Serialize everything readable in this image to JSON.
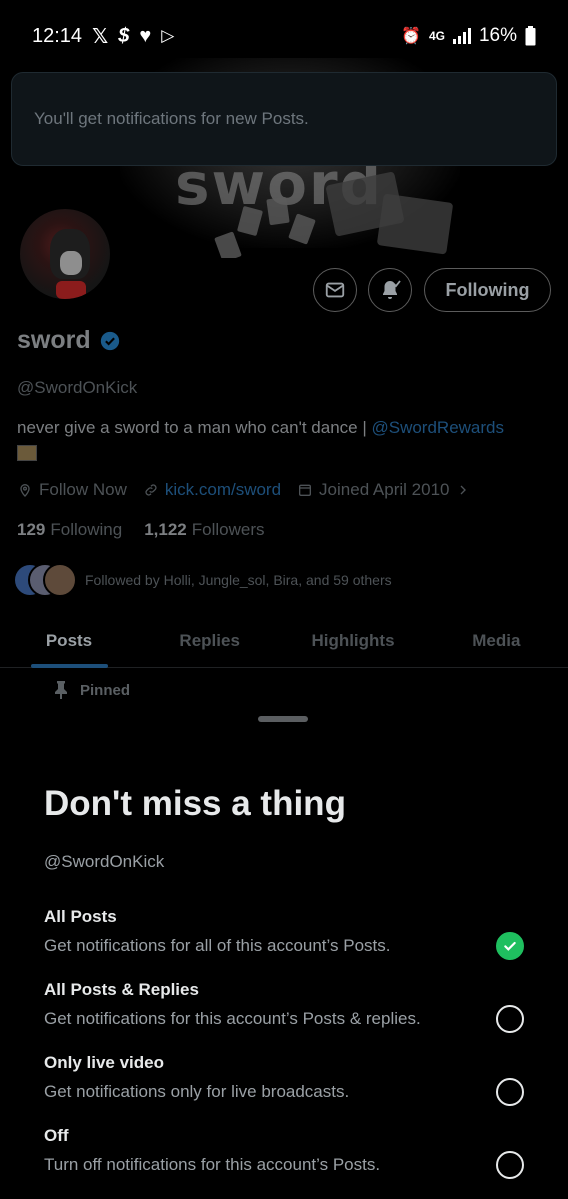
{
  "status_bar": {
    "time": "12:14",
    "battery": "16%",
    "network": "4G"
  },
  "toast": {
    "message": "You'll get notifications for new Posts."
  },
  "profile": {
    "name": "sword",
    "handle": "@SwordOnKick",
    "bio_text": "never give a sword to a man who can't dance | ",
    "bio_mention": "@SwordRewards",
    "location": "Follow Now",
    "website": "kick.com/sword",
    "joined": "Joined April 2010",
    "following_count": "129",
    "following_label": "Following",
    "followers_count": "1,122",
    "followers_label": "Followers",
    "followed_by": "Followed by Holli, Jungle_sol, Bira, and 59 others",
    "follow_button": "Following"
  },
  "tabs": [
    "Posts",
    "Replies",
    "Highlights",
    "Media"
  ],
  "pinned_label": "Pinned",
  "sheet": {
    "title": "Don't miss a thing",
    "handle": "@SwordOnKick",
    "options": [
      {
        "title": "All Posts",
        "desc": "Get notifications for all of this account’s Posts.",
        "selected": true
      },
      {
        "title": "All Posts & Replies",
        "desc": "Get notifications for this account’s Posts & replies.",
        "selected": false
      },
      {
        "title": "Only live video",
        "desc": "Get notifications only for live broadcasts.",
        "selected": false
      },
      {
        "title": "Off",
        "desc": "Turn off notifications for this account’s Posts.",
        "selected": false
      }
    ]
  },
  "colors": {
    "accent": "#1fbf5f",
    "link_dim": "#1d4f7a",
    "verified": "#1d9bf0"
  }
}
